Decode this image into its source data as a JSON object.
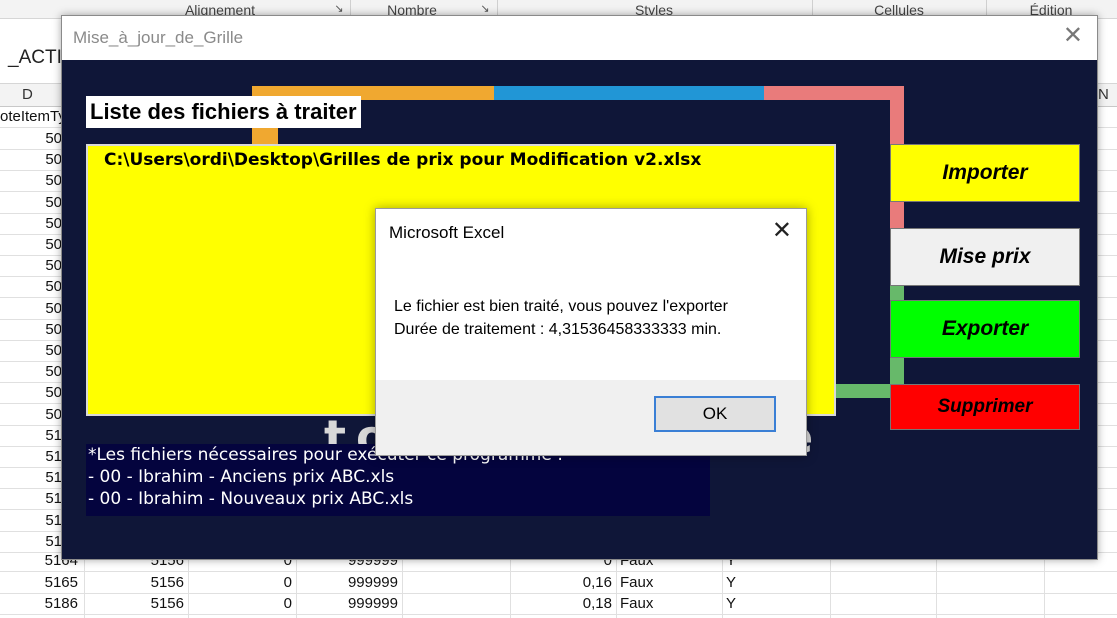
{
  "excel": {
    "ribbon_groups": [
      "Alignement",
      "Nombre",
      "Styles",
      "Cellules",
      "Édition"
    ],
    "name_box": "_ACTI",
    "column_d": "D",
    "column_n": "N",
    "header_cell": "oteItemTy",
    "left_values": [
      "50",
      "50",
      "50",
      "50",
      "50",
      "50",
      "50",
      "50",
      "50",
      "50",
      "50",
      "50",
      "50",
      "50",
      "51",
      "51",
      "51",
      "51",
      "51",
      "51"
    ],
    "rows": [
      {
        "a": "5164",
        "b": "5156",
        "c": "0",
        "d": "999999",
        "e": "0",
        "f": "Faux",
        "g": "Y"
      },
      {
        "a": "5165",
        "b": "5156",
        "c": "0",
        "d": "999999",
        "e": "0,16",
        "f": "Faux",
        "g": "Y"
      },
      {
        "a": "5186",
        "b": "5156",
        "c": "0",
        "d": "999999",
        "e": "0,18",
        "f": "Faux",
        "g": "Y"
      }
    ]
  },
  "userform": {
    "title": "Mise_à_jour_de_Grille",
    "list_label": "Liste des fichiers à traiter",
    "list_items": [
      "C:\\Users\\ordi\\Desktop\\Grilles de prix pour Modification v2.xlsx"
    ],
    "notes": [
      "*Les fichiers nécessaires pour exécuter ce programme :",
      "- 00 - Ibrahim - Anciens prix ABC.xls",
      "- 00 - Ibrahim - Nouveaux prix ABC.xls"
    ],
    "buttons": {
      "import": "Importer",
      "mise_prix": "Mise prix",
      "export": "Exporter",
      "delete": "Supprimer"
    },
    "colors": {
      "background": "#0f1638",
      "list_bg": "#ffff00",
      "import": "#ffff00",
      "export": "#00ff00",
      "delete": "#ff0000"
    }
  },
  "msgbox": {
    "title": "Microsoft Excel",
    "line1": "Le fichier est bien traité, vous pouvez l'exporter",
    "line2": "Durée de traitement : 4,31536458333333 min.",
    "ok_label": "OK"
  }
}
